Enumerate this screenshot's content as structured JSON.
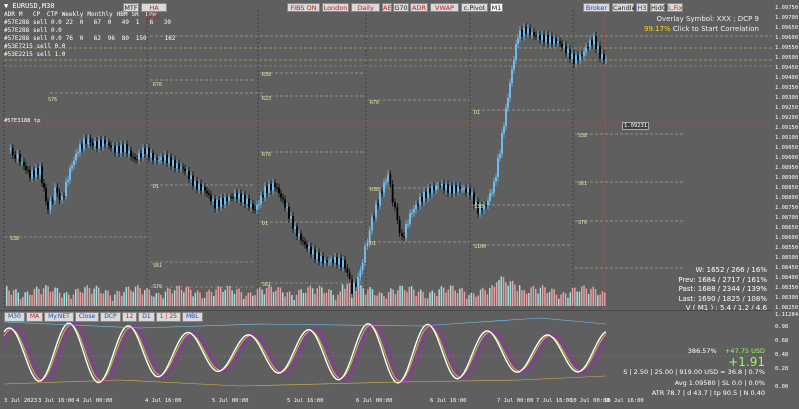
{
  "symbol": "▼ EURUSD,M30",
  "stats_table": {
    "header": [
      "ADR",
      "M",
      "CP",
      "CTP",
      "Weekly",
      "Monthly",
      "HBM",
      "SR",
      "Low"
    ],
    "rows": [
      [
        "#57E288 sell 0.0",
        "22",
        "0",
        "67",
        "0",
        "49",
        "1",
        "6",
        "30"
      ],
      [
        "#57E288 sell 0.0",
        "",
        "",
        "",
        "",
        "",
        "",
        "",
        ""
      ],
      [
        "#57E288 sell 0.0",
        "76",
        "0",
        "62",
        "96",
        "80",
        "150",
        "",
        "162"
      ],
      [
        "#53E7215 sell 0.0",
        "",
        "",
        "",
        "",
        "",
        "",
        "",
        ""
      ],
      [
        "#53E2215 sell 1.0",
        "",
        "",
        "",
        "",
        "",
        "",
        "",
        ""
      ]
    ]
  },
  "left_label": "#57E3188 tp",
  "toolbar": {
    "group1": [
      {
        "label": "MTF",
        "style": "normal"
      },
      {
        "label": "HA M30",
        "style": "red"
      }
    ],
    "group2": [
      {
        "label": "FIBS ON",
        "style": "red"
      },
      {
        "label": "London",
        "style": "red"
      },
      {
        "label": "Daily",
        "style": "red"
      },
      {
        "label": "AE",
        "style": "red"
      },
      {
        "label": "G70",
        "style": "normal"
      },
      {
        "label": "ADR",
        "style": "red"
      },
      {
        "label": "VWAP",
        "style": "red"
      },
      {
        "label": "c.Pivot",
        "style": "normal"
      },
      {
        "label": "M1",
        "style": "dark"
      }
    ],
    "group3": [
      {
        "label": "Broker",
        "style": "blue"
      },
      {
        "label": "Candle",
        "style": "normal"
      },
      {
        "label": "H3",
        "style": "blue"
      },
      {
        "label": "HidO",
        "style": "normal"
      },
      {
        "label": "L.Fix",
        "style": "red"
      }
    ]
  },
  "overlay": {
    "line1": "Overlay Symbol: XXX ; DCP 9",
    "line2_hl": "99.17%",
    "line2": " Click to Start Correlation"
  },
  "price_axis": [
    "1.09750",
    "1.09700",
    "1.09650",
    "1.09600",
    "1.09550",
    "1.09500",
    "1.09450",
    "1.09400",
    "1.09350",
    "1.09300",
    "1.09250",
    "1.09200",
    "1.09150",
    "1.09100",
    "1.09050",
    "1.09000",
    "1.08950",
    "1.08900",
    "1.08850",
    "1.08800",
    "1.08750",
    "1.08700",
    "1.08650",
    "1.08600",
    "1.08550",
    "1.08500",
    "1.08450",
    "1.08400",
    "1.08350",
    "1.08300",
    "1.08250"
  ],
  "price_marker": "1.09231",
  "week_info": {
    "w": "W: 1652 / 266 / 16%",
    "prev": "Prev: 1684 / 2717 / 161%",
    "past": "Past: 1688 / 2344 / 139%",
    "last": "Last: 1690 / 1825 / 108%",
    "v": "V ( M1 ) : 5.4 / 1.2 / 4.6"
  },
  "indicator_buttons": [
    {
      "label": "M30",
      "style": "normal"
    },
    {
      "label": "MA",
      "style": "red"
    },
    {
      "label": "My.NET",
      "style": "normal"
    },
    {
      "label": "Close",
      "style": "normal"
    },
    {
      "label": "DCP",
      "style": "normal"
    },
    {
      "label": "12",
      "style": "red"
    },
    {
      "label": "D1",
      "style": "normal"
    },
    {
      "label": "1 | 25",
      "style": "red"
    },
    {
      "label": "MBL",
      "style": "normal"
    }
  ],
  "indicator_info": {
    "pct": "386.57%",
    "usd": "+47.75 USD",
    "big": "+1.91",
    "line3": "S | 2.50 | 25.00 | 919.00 USD = 36.8 | 0.7%",
    "line4": "Avg 1.09580 | SL 0.0 | 0.0%",
    "line5": "ATR 78.7 | d 43.7 | tp 90.5 | N 0.40"
  },
  "indicator_axis": [
    "1.11284",
    "0.98",
    "0.68",
    "0.48",
    "0.28",
    "0.00"
  ],
  "time_axis": [
    "3 Jul 2023",
    "3 Jul 16:00",
    "4 Jul 00:00",
    "4 Jul 16:00",
    "5 Jul 00:00",
    "5 Jul 16:00",
    "6 Jul 00:00",
    "6 Jul 16:00",
    "7 Jul 00:00",
    "7 Jul 16:00",
    "10 Jul 00:00",
    "10 Jul 16:00"
  ],
  "colors": {
    "background": "#5f5f5f",
    "bull_candle": "#6ec6ff",
    "bear_candle": "#000000",
    "volume": "#e6a0a0",
    "osc_white": "#ffffff",
    "osc_purple": "#9b2bb3",
    "osc_yellow": "#d2b24a"
  }
}
